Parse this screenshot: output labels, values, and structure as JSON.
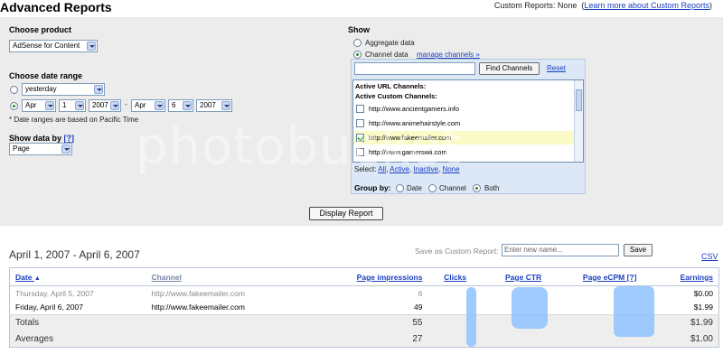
{
  "header": {
    "title": "Advanced Reports",
    "custom_reports_label": "Custom Reports:",
    "custom_reports_value": "None",
    "learn_more_link": "Learn more about Custom Reports"
  },
  "choose_product": {
    "label": "Choose product",
    "selected": "AdSense for Content"
  },
  "date_range": {
    "label": "Choose date range",
    "preset_selected": "yesterday",
    "from_month": "Apr",
    "from_day": "1",
    "from_year": "2007",
    "to_month": "Apr",
    "to_day": "6",
    "to_year": "2007",
    "separator": "-",
    "note": "* Date ranges are based on Pacific Time"
  },
  "show_data_by": {
    "label": "Show data by",
    "help": "[?]",
    "selected": "Page"
  },
  "show": {
    "label": "Show",
    "aggregate_label": "Aggregate data",
    "channel_label": "Channel data",
    "manage_channels_link": "manage channels »",
    "find_button": "Find Channels",
    "reset_link": "Reset",
    "url_channels_heading": "Active URL Channels:",
    "custom_channels_heading": "Active Custom Channels:",
    "channels": [
      {
        "name": "http://www.ancientgamers.info",
        "checked": false
      },
      {
        "name": "http://www.animehairstyle.com",
        "checked": false
      },
      {
        "name": "http://www.fakeemailer.com",
        "checked": true
      },
      {
        "name": "http://www.gamerswii.com",
        "checked": false
      }
    ],
    "select_label": "Select:",
    "select_all": "All",
    "select_active": "Active",
    "select_inactive": "Inactive",
    "select_none": "None",
    "group_by_label": "Group by:",
    "group_date": "Date",
    "group_channel": "Channel",
    "group_both": "Both"
  },
  "display_button": "Display Report",
  "report": {
    "title": "April 1, 2007 - April 6, 2007",
    "save_as_label": "Save as Custom Report:",
    "save_placeholder": "Enter new name...",
    "save_button": "Save",
    "csv_link": "CSV",
    "columns": {
      "date": "Date",
      "channel": "Channel",
      "page_impressions": "Page impressions",
      "clicks": "Clicks",
      "page_ctr_prefix": "Page",
      "page_ctr": "CTR",
      "page_ecpm": "Page eCPM",
      "ecpm_help": "[?]",
      "earnings": "Earnings"
    },
    "rows": [
      {
        "date": "Thursday, April 5, 2007",
        "channel": "http://www.fakeemailer.com",
        "impressions": "6",
        "earnings": "$0.00"
      },
      {
        "date": "Friday, April 6, 2007",
        "channel": "http://www.fakeemailer.com",
        "impressions": "49",
        "earnings": "$1.99"
      }
    ],
    "totals": {
      "label": "Totals",
      "impressions": "55",
      "earnings": "$1.99"
    },
    "averages": {
      "label": "Averages",
      "impressions": "27",
      "earnings": "$1.00"
    }
  },
  "watermark": "photobucket",
  "colors": {
    "panel_bg": "#ececec",
    "link": "#1a3fbf",
    "channel_box": "#dde8f6",
    "selected_row": "#fbfbc8",
    "redaction": "#8ec2ff"
  }
}
